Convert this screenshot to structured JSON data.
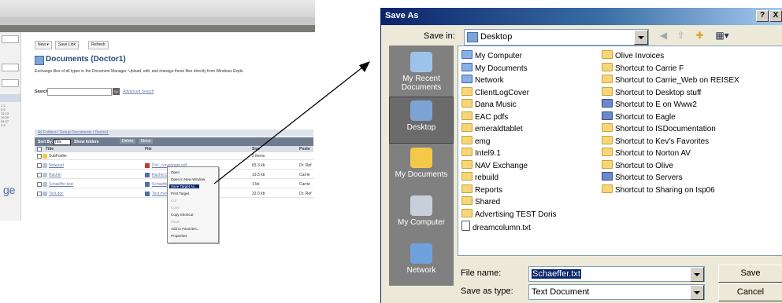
{
  "browser": {
    "toolbar": {
      "new": "New",
      "save_link": "Save Link",
      "refresh": "Refresh"
    },
    "doc_title": "Documents (Doctor1)",
    "description": "Exchange files of all types in the Document Manager. Upload, edit, and manage these files directly from Windows Explo",
    "search_label": "Search:",
    "search_go": "Go",
    "advanced_search": "Advanced Search",
    "breadcrumb": "All Folders / Group Documents / Doctor1",
    "sort_by_label": "Sort By:",
    "sort_value": "Title",
    "show_folders": "Show folders",
    "delete": "Delete",
    "move": "Move",
    "columns": {
      "title": "Title",
      "file": "File",
      "size": "Size",
      "posted": "Poste"
    },
    "rows": [
      {
        "title": "SubFolder",
        "file": "",
        "size": "2 items",
        "posted": ""
      },
      {
        "title": "Notepad",
        "file": "Doc_consignapi.pdf",
        "size": "83.3 kb",
        "posted": "Dr. Ref"
      },
      {
        "title": "Rachel",
        "file": "Rachel.doc",
        "size": "19.5 kb",
        "posted": "Carrie"
      },
      {
        "title": "Schaeffer test",
        "file": "Schaeffer",
        "size": "1 kb",
        "posted": "Carrie"
      },
      {
        "title": "Test.doc",
        "file": "Test.mem",
        "size": "32.0 kb",
        "posted": "Dr. Ref"
      }
    ],
    "context_menu": [
      "Open",
      "Open in New Window",
      "Save Target As...",
      "Print Target",
      "Cut",
      "Copy",
      "Copy Shortcut",
      "Paste",
      "Add to Favorites...",
      "Properties"
    ],
    "side_text": "ge"
  },
  "dialog": {
    "title": "Save As",
    "help_btn": "?",
    "close_btn": "X",
    "save_in_label": "Save in:",
    "save_in_value": "Desktop",
    "places": [
      "My Recent Documents",
      "Desktop",
      "My Documents",
      "My Computer",
      "Network"
    ],
    "files_col1": [
      {
        "name": "My Computer",
        "kind": "special"
      },
      {
        "name": "My Documents",
        "kind": "special"
      },
      {
        "name": "Network",
        "kind": "special"
      },
      {
        "name": "ClientLogCover",
        "kind": "folder"
      },
      {
        "name": "Dana Music",
        "kind": "folder"
      },
      {
        "name": "EAC pdfs",
        "kind": "folder"
      },
      {
        "name": "emeraldtablet",
        "kind": "folder"
      },
      {
        "name": "emg",
        "kind": "folder"
      },
      {
        "name": "Intel9.1",
        "kind": "folder"
      },
      {
        "name": "NAV Exchange",
        "kind": "folder"
      },
      {
        "name": "rebuild",
        "kind": "folder"
      },
      {
        "name": "Reports",
        "kind": "folder"
      },
      {
        "name": "Shared",
        "kind": "folder"
      },
      {
        "name": "Advertising TEST Doris",
        "kind": "folder"
      },
      {
        "name": "dreamcolumn.txt",
        "kind": "txt"
      }
    ],
    "files_col2": [
      {
        "name": "Olive Invoices",
        "kind": "folder"
      },
      {
        "name": "Shortcut to Carrie F",
        "kind": "folder"
      },
      {
        "name": "Shortcut to Carrie_Web on REISEX",
        "kind": "folder"
      },
      {
        "name": "Shortcut to Desktop stuff",
        "kind": "folder"
      },
      {
        "name": "Shortcut to E on Www2",
        "kind": "shortcut"
      },
      {
        "name": "Shortcut to Eagle",
        "kind": "shortcut"
      },
      {
        "name": "Shortcut to ISDocumentation",
        "kind": "folder"
      },
      {
        "name": "Shortcut to Kev's Favorites",
        "kind": "folder"
      },
      {
        "name": "Shortcut to Norton AV",
        "kind": "folder"
      },
      {
        "name": "Shortcut to Olive",
        "kind": "folder"
      },
      {
        "name": "Shortcut to Servers",
        "kind": "shortcut"
      },
      {
        "name": "Shortcut to Sharing on Isp06",
        "kind": "folder"
      }
    ],
    "file_name_label": "File name:",
    "file_name_value": "Schaeffer.txt",
    "save_type_label": "Save as type:",
    "save_type_value": "Text Document",
    "save_btn": "Save",
    "cancel_btn": "Cancel"
  },
  "colors": {
    "title_start": "#0a246a",
    "title_end": "#a6caf0",
    "places_bg": "#808080",
    "dialog_bg": "#ece9d8"
  }
}
